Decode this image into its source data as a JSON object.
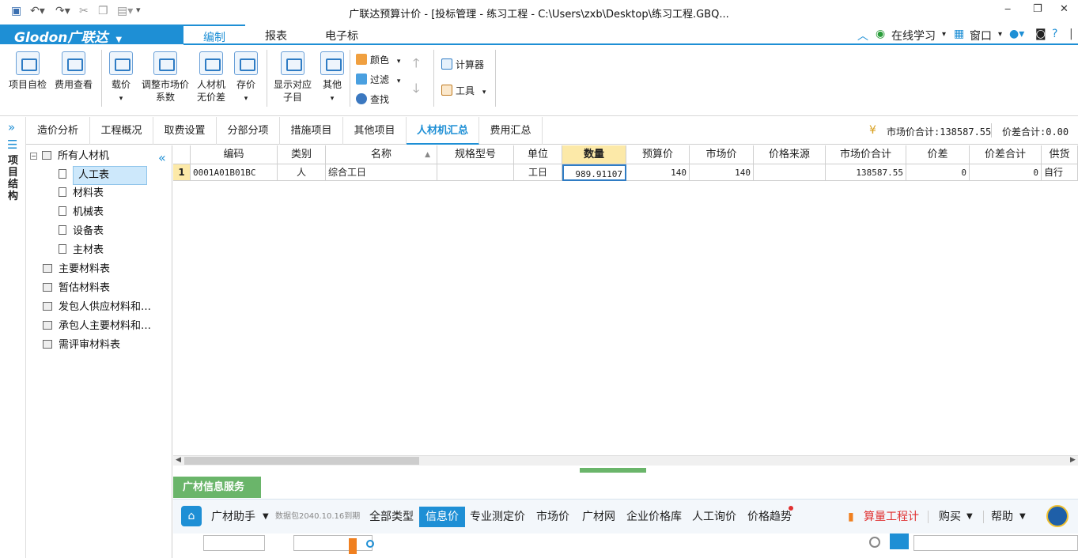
{
  "window": {
    "title": "广联达预算计价 - [投标管理 - 练习工程 - C:\\Users\\zxb\\Desktop\\练习工程.GBQ..."
  },
  "menubar": {
    "logo": "Glodon广联达",
    "tabs": [
      "编制",
      "报表",
      "电子标"
    ],
    "right": {
      "online_learning": "在线学习",
      "window": "窗口"
    }
  },
  "ribbon": {
    "buttons": {
      "self_check": "项目自检",
      "fee_view": "费用查看",
      "load_price": "载价",
      "adjust_line1": "调整市场价",
      "adjust_line2": "系数",
      "labor_line1": "人材机",
      "labor_line2": "无价差",
      "save_price": "存价",
      "show_line1": "显示对应",
      "show_line2": "子目",
      "other": "其他"
    },
    "small": {
      "color": "颜色",
      "filter": "过滤",
      "find": "查找",
      "calculator": "计算器",
      "tools": "工具"
    }
  },
  "side_strip": {
    "label": "项目结构"
  },
  "tabs": [
    "造价分析",
    "工程概况",
    "取费设置",
    "分部分项",
    "措施项目",
    "其他项目",
    "人材机汇总",
    "费用汇总"
  ],
  "summary": {
    "market_total_label": "市场价合计:138587.55",
    "diff_total_label": "价差合计:0.00"
  },
  "tree": {
    "root": "所有人材机",
    "children": [
      "人工表",
      "材料表",
      "机械表",
      "设备表",
      "主材表"
    ],
    "groups": [
      "主要材料表",
      "暂估材料表",
      "发包人供应材料和…",
      "承包人主要材料和…",
      "需评审材料表"
    ]
  },
  "grid": {
    "columns": [
      "编码",
      "类别",
      "名称",
      "规格型号",
      "单位",
      "数量",
      "预算价",
      "市场价",
      "价格来源",
      "市场价合计",
      "价差",
      "价差合计",
      "供货"
    ],
    "rows": [
      {
        "index": "1",
        "code": "0001A01B01BC",
        "category": "人",
        "name": "综合工日",
        "spec": "",
        "unit": "工日",
        "qty": "989.91107",
        "budget_price": "140",
        "market_price": "140",
        "source": "",
        "market_total": "138587.55",
        "diff": "0",
        "diff_total": "0",
        "supply": "自行"
      }
    ]
  },
  "bottom": {
    "service_title": "广材信息服务",
    "assistant": "广材助手",
    "assistant_note": "数据包2040.10.16到期",
    "tabs": [
      "全部类型",
      "信息价",
      "专业测定价",
      "市场价",
      "广材网",
      "企业价格库",
      "人工询价",
      "价格趋势"
    ],
    "right": {
      "quantity_calc": "算量工程计",
      "buy": "购买",
      "help": "帮助"
    }
  },
  "colors": {
    "accent": "#1e8fd5",
    "service_green": "#6ab56a",
    "qty_header": "#fce9a8"
  }
}
